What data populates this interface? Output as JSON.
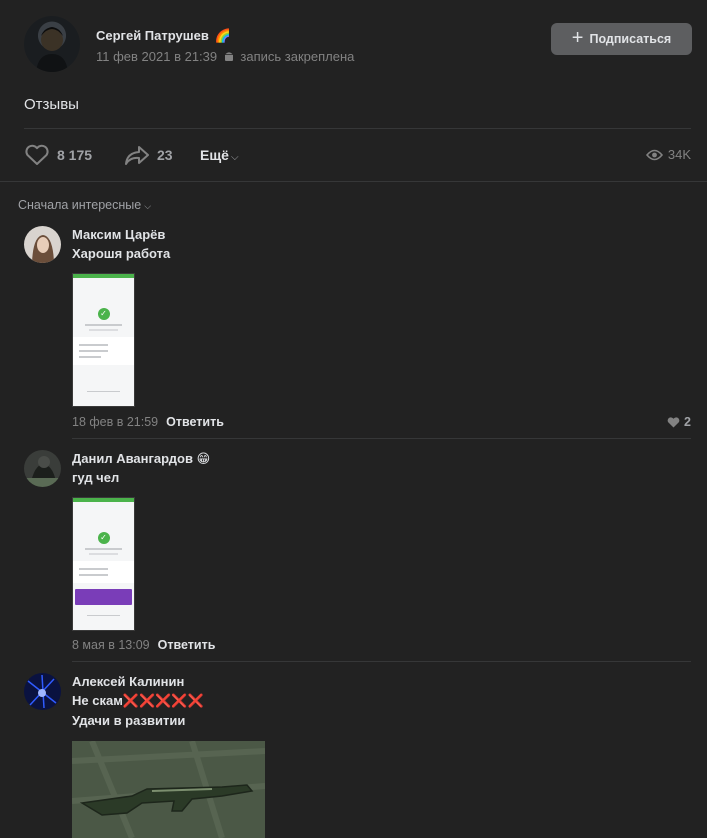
{
  "post": {
    "author": "Сергей Патрушев",
    "author_emoji": "🌈",
    "date": "11 фев 2021 в 21:39",
    "pinned": "запись закреплена",
    "subscribe_label": "Подписаться",
    "text": "Отзывы",
    "likes": "8 175",
    "shares": "23",
    "more_label": "Ещё",
    "views": "34K"
  },
  "comments_sort": "Сначала интересные",
  "comments": [
    {
      "author": "Максим Царёв",
      "text": "Харошя работа",
      "date": "18 фев в 21:59",
      "reply": "Ответить",
      "likes": "2"
    },
    {
      "author": "Данил Авангардов",
      "author_emoji": "😁",
      "text": "гуд чел",
      "date": "8 мая в 13:09",
      "reply": "Ответить"
    },
    {
      "author": "Алексей Калинин",
      "text_line1": "Не скам❌❌❌❌❌",
      "text_line2": "Удачи в развитии"
    }
  ],
  "colors": {
    "background": "#222222",
    "text": "#e1e3e6",
    "secondary": "#828282",
    "button": "#5d5e60",
    "accent_green": "#4bb34b"
  }
}
